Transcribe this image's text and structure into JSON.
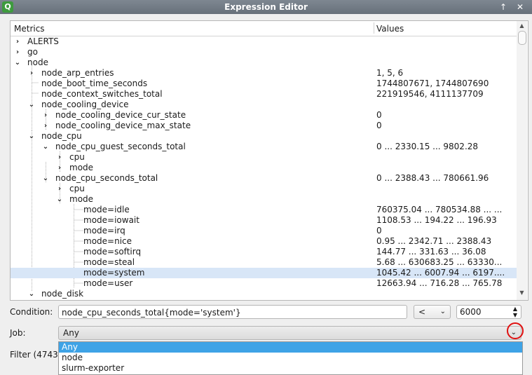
{
  "window": {
    "title": "Expression Editor",
    "app_icon": "Q"
  },
  "tree": {
    "headers": {
      "metrics": "Metrics",
      "values": "Values"
    },
    "rows": [
      {
        "label": "ALERTS",
        "value": "",
        "arrow": "›"
      },
      {
        "label": "go",
        "value": "",
        "arrow": "›"
      },
      {
        "label": "node",
        "value": "",
        "arrow": "⌄"
      },
      {
        "label": "node_arp_entries",
        "value": "1, 5, 6",
        "arrow": "›"
      },
      {
        "label": "node_boot_time_seconds",
        "value": "1744807671, 1744807690",
        "arrow": ""
      },
      {
        "label": "node_context_switches_total",
        "value": "221919546, 4111137709",
        "arrow": ""
      },
      {
        "label": "node_cooling_device",
        "value": "",
        "arrow": "⌄"
      },
      {
        "label": "node_cooling_device_cur_state",
        "value": "0",
        "arrow": "›"
      },
      {
        "label": "node_cooling_device_max_state",
        "value": "0",
        "arrow": "›"
      },
      {
        "label": "node_cpu",
        "value": "",
        "arrow": "⌄"
      },
      {
        "label": "node_cpu_guest_seconds_total",
        "value": "0 ... 2330.15 ... 9802.28",
        "arrow": "⌄"
      },
      {
        "label": "cpu",
        "value": "",
        "arrow": "›"
      },
      {
        "label": "mode",
        "value": "",
        "arrow": "›"
      },
      {
        "label": "node_cpu_seconds_total",
        "value": "0 ... 2388.43 ... 780661.96",
        "arrow": "⌄"
      },
      {
        "label": "cpu",
        "value": "",
        "arrow": "›"
      },
      {
        "label": "mode",
        "value": "",
        "arrow": "⌄"
      },
      {
        "label": "mode=idle",
        "value": "760375.04 ... 780534.88 ... ...",
        "arrow": ""
      },
      {
        "label": "mode=iowait",
        "value": "1108.53 ... 194.22 ... 196.93",
        "arrow": ""
      },
      {
        "label": "mode=irq",
        "value": "0",
        "arrow": ""
      },
      {
        "label": "mode=nice",
        "value": "0.95 ... 2342.71 ... 2388.43",
        "arrow": ""
      },
      {
        "label": "mode=softirq",
        "value": "144.77 ... 331.63 ... 36.08",
        "arrow": ""
      },
      {
        "label": "mode=steal",
        "value": "5.68 ... 630683.25 ... 63330...",
        "arrow": ""
      },
      {
        "label": "mode=system",
        "value": "1045.42 ... 6007.94 ... 6197....",
        "arrow": ""
      },
      {
        "label": "mode=user",
        "value": "12663.94 ... 716.28 ... 765.78",
        "arrow": ""
      },
      {
        "label": "node_disk",
        "value": "",
        "arrow": "⌄"
      }
    ]
  },
  "condition": {
    "label": "Condition:",
    "expression": "node_cpu_seconds_total{mode='system'}",
    "operator": "<",
    "threshold": "6000"
  },
  "job": {
    "label": "Job:",
    "selected": "Any",
    "options": [
      "Any",
      "node",
      "slurm-exporter"
    ]
  },
  "filter": {
    "label": "Filter (4743"
  },
  "colors": {
    "selection": "#3ea3e6",
    "highlight": "#e01010"
  }
}
